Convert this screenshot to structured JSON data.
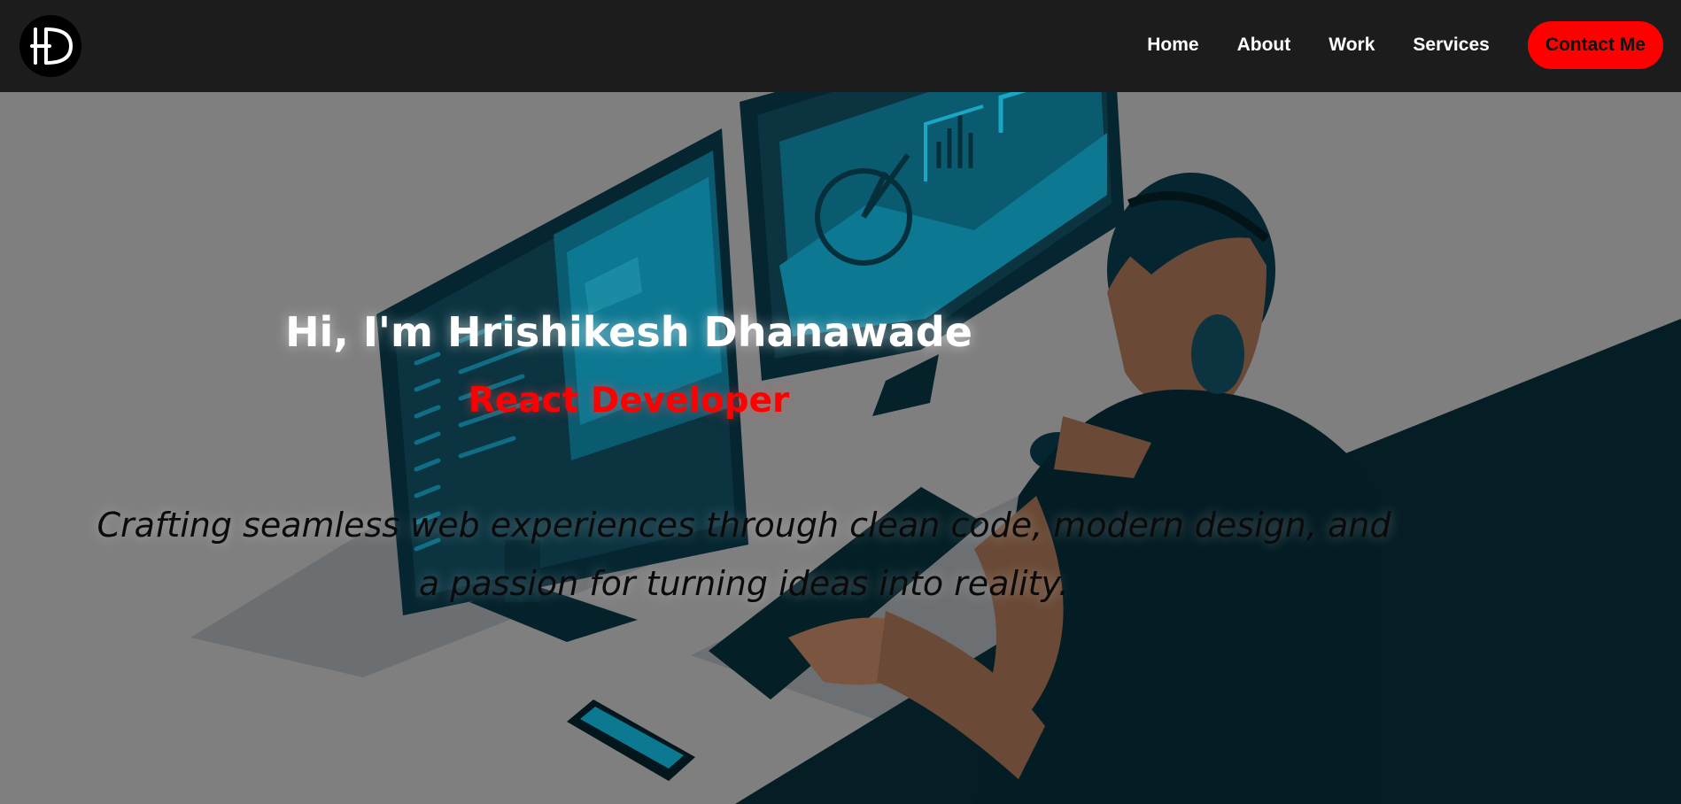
{
  "brand": {
    "logo_text": "HD",
    "logo_icon": "hd-monogram-logo"
  },
  "nav": {
    "links": [
      "Home",
      "About",
      "Work",
      "Services"
    ],
    "contact_label": "Contact Me"
  },
  "hero": {
    "headline": "Hi, I'm Hrishikesh Dhanawade",
    "role": "React Developer",
    "tagline": "Crafting seamless web experiences through clean code, modern design, and a passion for turning ideas into reality.",
    "illustration": "developer-at-dual-monitors-illustration"
  },
  "colors": {
    "navbar_bg": "#1c1c1c",
    "accent_red": "#ff0000",
    "hero_overlay": "#7f7f7f",
    "illustration_dark": "#0b2a33",
    "illustration_teal": "#0a6a80"
  }
}
